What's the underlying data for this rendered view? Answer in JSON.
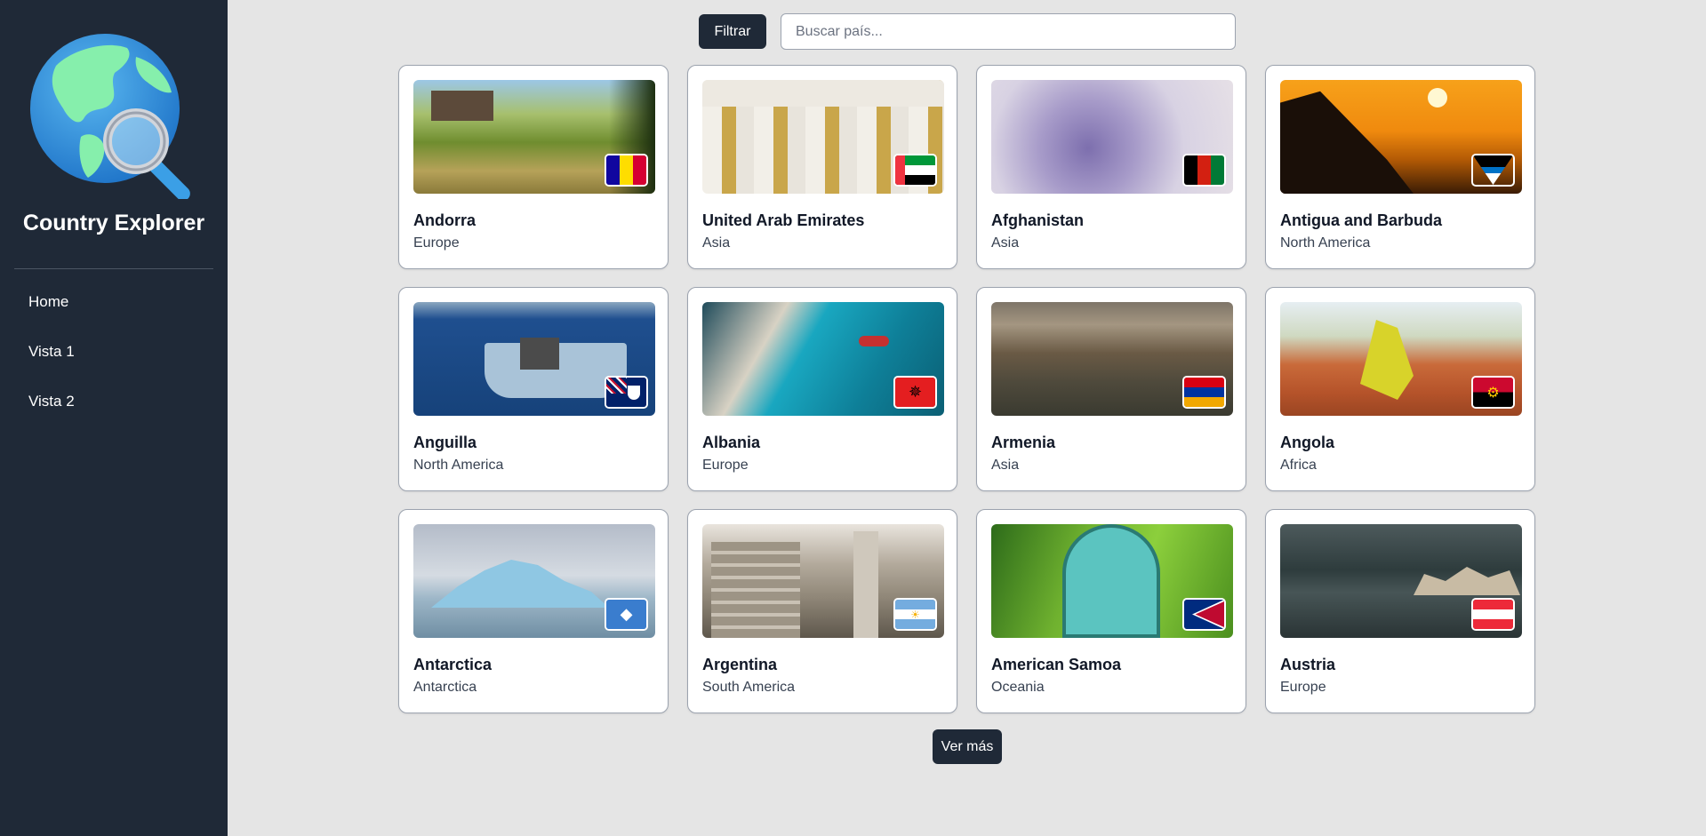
{
  "app": {
    "title": "Country Explorer"
  },
  "sidebar": {
    "items": [
      {
        "label": "Home"
      },
      {
        "label": "Vista 1"
      },
      {
        "label": "Vista 2"
      }
    ]
  },
  "toolbar": {
    "filter_label": "Filtrar",
    "search_placeholder": "Buscar país...",
    "search_value": ""
  },
  "countries": [
    {
      "name": "Andorra",
      "region": "Europe"
    },
    {
      "name": "United Arab Emirates",
      "region": "Asia"
    },
    {
      "name": "Afghanistan",
      "region": "Asia"
    },
    {
      "name": "Antigua and Barbuda",
      "region": "North America"
    },
    {
      "name": "Anguilla",
      "region": "North America"
    },
    {
      "name": "Albania",
      "region": "Europe"
    },
    {
      "name": "Armenia",
      "region": "Asia"
    },
    {
      "name": "Angola",
      "region": "Africa"
    },
    {
      "name": "Antarctica",
      "region": "Antarctica"
    },
    {
      "name": "Argentina",
      "region": "South America"
    },
    {
      "name": "American Samoa",
      "region": "Oceania"
    },
    {
      "name": "Austria",
      "region": "Europe"
    }
  ],
  "pagination": {
    "more_label": "Ver más"
  },
  "colors": {
    "sidebar_bg": "#1f2937",
    "page_bg": "#e5e5e5",
    "button_bg": "#1f2937"
  }
}
